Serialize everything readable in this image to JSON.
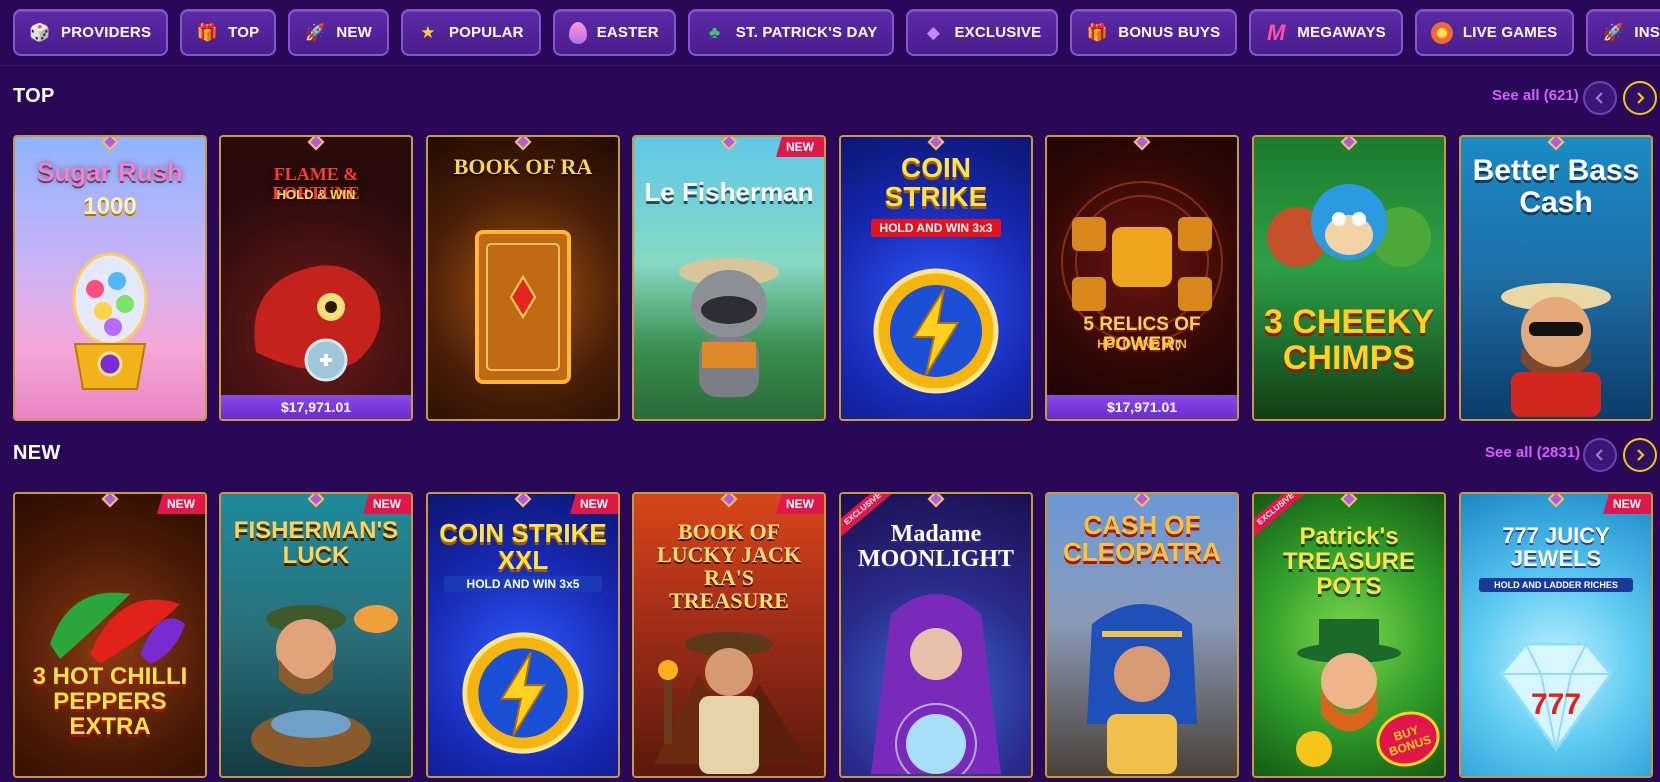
{
  "categories": [
    {
      "label": "PROVIDERS",
      "icon": "dice-icon"
    },
    {
      "label": "TOP",
      "icon": "gift-icon"
    },
    {
      "label": "NEW",
      "icon": "rocket-icon"
    },
    {
      "label": "POPULAR",
      "icon": "star-icon"
    },
    {
      "label": "EASTER",
      "icon": "easter-egg-icon"
    },
    {
      "label": "ST. PATRICK'S DAY",
      "icon": "leprechaun-hat-icon"
    },
    {
      "label": "EXCLUSIVE",
      "icon": "gem-icon"
    },
    {
      "label": "BONUS BUYS",
      "icon": "bonus-gift-icon"
    },
    {
      "label": "MEGAWAYS",
      "icon": "megaways-m-icon"
    },
    {
      "label": "LIVE GAMES",
      "icon": "live-dial-icon"
    },
    {
      "label": "INSTANT GAMES",
      "icon": "instant-rocket-icon"
    }
  ],
  "sections": [
    {
      "title": "TOP",
      "see_all": "See all (621)",
      "games": [
        {
          "name": "Sugar Rush",
          "sub": "1000",
          "jackpot": null,
          "badge": null
        },
        {
          "name": "FLAME & FORTUNE",
          "sub": "HOLD & WIN",
          "jackpot": "$17,971.01",
          "badge": null
        },
        {
          "name": "BOOK OF RA",
          "sub": "",
          "jackpot": null,
          "badge": null
        },
        {
          "name": "Le Fisherman",
          "sub": "",
          "jackpot": null,
          "badge": "NEW"
        },
        {
          "name": "COIN STRIKE",
          "sub": "HOLD AND WIN 3x3",
          "jackpot": null,
          "badge": null
        },
        {
          "name": "5 RELICS OF POWER:",
          "sub": "HOLD AND WIN",
          "jackpot": "$17,971.01",
          "badge": null
        },
        {
          "name": "3 CHEEKY CHIMPS",
          "sub": "",
          "jackpot": null,
          "badge": null
        },
        {
          "name": "Better Bass Cash",
          "sub": "",
          "jackpot": null,
          "badge": null
        }
      ]
    },
    {
      "title": "NEW",
      "see_all": "See all (2831)",
      "games": [
        {
          "name": "3 HOT CHILLI PEPPERS EXTRA",
          "sub": "",
          "jackpot": null,
          "badge": "NEW"
        },
        {
          "name": "FISHERMAN'S LUCK",
          "sub": "",
          "jackpot": null,
          "badge": "NEW"
        },
        {
          "name": "COIN STRIKE XXL",
          "sub": "HOLD AND WIN 3x5",
          "jackpot": null,
          "badge": "NEW"
        },
        {
          "name": "BOOK OF LUCKY JACK RA'S TREASURE",
          "sub": "",
          "jackpot": null,
          "badge": "NEW"
        },
        {
          "name": "Madame MOONLIGHT",
          "sub": "",
          "jackpot": null,
          "badge": "EXCLUSIVE"
        },
        {
          "name": "CASH OF CLEOPATRA",
          "sub": "",
          "jackpot": null,
          "badge": null
        },
        {
          "name": "Patrick's TREASURE POTS",
          "sub": "",
          "jackpot": null,
          "badge": "EXCLUSIVE"
        },
        {
          "name": "777 JUICY JEWELS",
          "sub": "HOLD AND LADDER RICHES",
          "jackpot": null,
          "badge": "NEW"
        }
      ]
    }
  ],
  "bonus_buy_stamp": "BUY BONUS",
  "colors": {
    "background": "#2a0858",
    "accent_pink": "#d65fff",
    "badge_red": "#e0174a",
    "frame_gold": "#c99a3a",
    "nav_active": "#f5c518"
  }
}
